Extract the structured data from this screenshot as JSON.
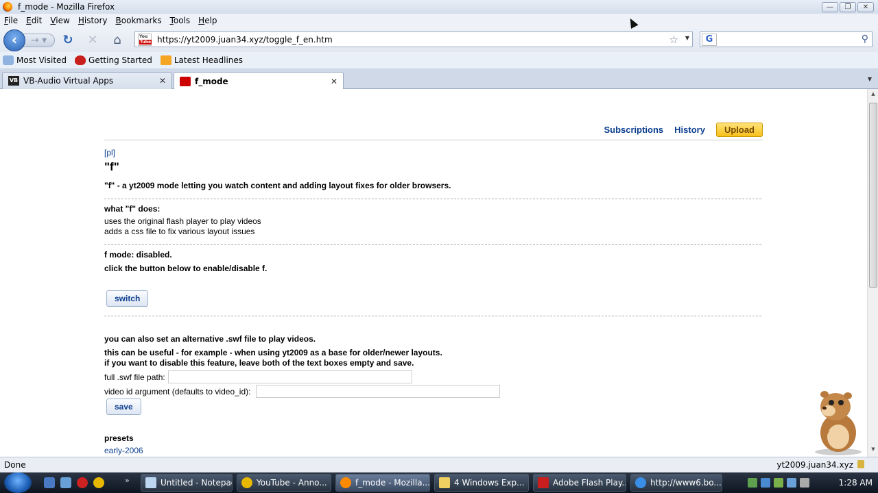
{
  "window": {
    "title": "f_mode - Mozilla Firefox",
    "min": "—",
    "max": "❐",
    "close": "✕"
  },
  "menu": {
    "items": [
      "File",
      "Edit",
      "View",
      "History",
      "Bookmarks",
      "Tools",
      "Help"
    ],
    "underlines": [
      "F",
      "E",
      "V",
      "H",
      "B",
      "T",
      "H"
    ]
  },
  "nav": {
    "url": "https://yt2009.juan34.xyz/toggle_f_en.htm",
    "search_value": ""
  },
  "bookmarks": [
    "Most Visited",
    "Getting Started",
    "Latest Headlines"
  ],
  "tabs": [
    {
      "label": "VB-Audio Virtual Apps",
      "icon": "vb-icon"
    },
    {
      "label": "f_mode",
      "icon": "youtube-icon"
    }
  ],
  "page": {
    "top_links": {
      "subscriptions": "Subscriptions",
      "history": "History",
      "upload": "Upload"
    },
    "lang_link": "[pl]",
    "heading": "\"f\"",
    "intro": "\"f\" - a yt2009 mode letting you watch content and adding layout fixes for older browsers.",
    "what_title": "what \"f\" does:",
    "what_items": [
      "uses the original flash player to play videos",
      "adds a css file to fix various layout issues"
    ],
    "status": "f mode: disabled.",
    "instruction": "click the button below to enable/disable f.",
    "switch_label": "switch",
    "alt_title": "you can also set an alternative .swf file to play videos.",
    "alt_desc1": "this can be useful - for example - when using yt2009 as a base for older/newer layouts.",
    "alt_desc2": "if you want to disable this feature, leave both of the text boxes empty and save.",
    "swf_label": "full .swf file path:",
    "vid_label": "video id argument (defaults to video_id):",
    "save_label": "save",
    "presets_title": "presets",
    "preset_first": "early-2006"
  },
  "status_bar": {
    "left": "Done",
    "right": "yt2009.juan34.xyz"
  },
  "taskbar": {
    "tasks": [
      "Untitled - Notepad",
      "YouTube - Anno...",
      "f_mode - Mozilla...",
      "4 Windows Exp...",
      "Adobe Flash Play...",
      "http://www6.bo..."
    ],
    "clock": "1:28 AM"
  }
}
